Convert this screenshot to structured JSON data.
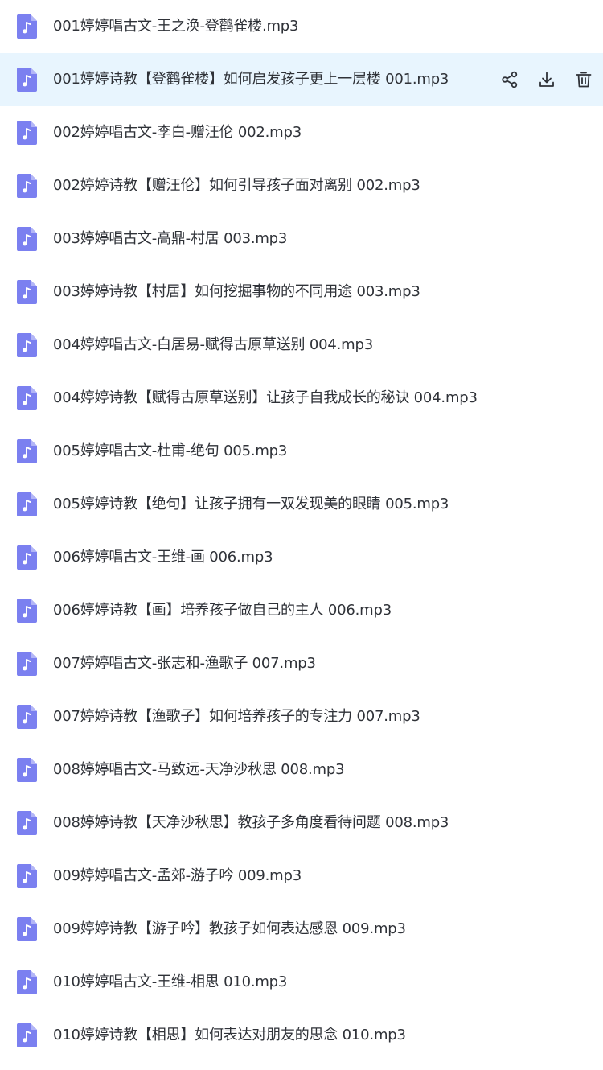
{
  "colors": {
    "icon_fill": "#7b80f0",
    "icon_fold": "#b3b6f7",
    "selected_row_bg": "#e8f5fe",
    "text": "#2f3238"
  },
  "file_icon": "music-file-icon",
  "selected_row_actions": [
    {
      "name": "share-icon"
    },
    {
      "name": "download-icon"
    },
    {
      "name": "delete-icon"
    }
  ],
  "files": [
    {
      "name": "001婷婷唱古文-王之涣-登鹳雀楼.mp3"
    },
    {
      "name": "001婷婷诗教【登鹳雀楼】如何启发孩子更上一层楼 001.mp3",
      "selected": true
    },
    {
      "name": "002婷婷唱古文-李白-赠汪伦 002.mp3"
    },
    {
      "name": "002婷婷诗教【赠汪伦】如何引导孩子面对离别 002.mp3"
    },
    {
      "name": "003婷婷唱古文-高鼎-村居 003.mp3"
    },
    {
      "name": "003婷婷诗教【村居】如何挖掘事物的不同用途 003.mp3"
    },
    {
      "name": "004婷婷唱古文-白居易-赋得古原草送别 004.mp3"
    },
    {
      "name": "004婷婷诗教【赋得古原草送别】让孩子自我成长的秘诀 004.mp3"
    },
    {
      "name": "005婷婷唱古文-杜甫-绝句 005.mp3"
    },
    {
      "name": "005婷婷诗教【绝句】让孩子拥有一双发现美的眼睛 005.mp3"
    },
    {
      "name": "006婷婷唱古文-王维-画 006.mp3"
    },
    {
      "name": "006婷婷诗教【画】培养孩子做自己的主人 006.mp3"
    },
    {
      "name": "007婷婷唱古文-张志和-渔歌子 007.mp3"
    },
    {
      "name": "007婷婷诗教【渔歌子】如何培养孩子的专注力 007.mp3"
    },
    {
      "name": "008婷婷唱古文-马致远-天净沙秋思 008.mp3"
    },
    {
      "name": "008婷婷诗教【天净沙秋思】教孩子多角度看待问题 008.mp3"
    },
    {
      "name": "009婷婷唱古文-孟郊-游子吟 009.mp3"
    },
    {
      "name": "009婷婷诗教【游子吟】教孩子如何表达感恩 009.mp3"
    },
    {
      "name": "010婷婷唱古文-王维-相思 010.mp3"
    },
    {
      "name": "010婷婷诗教【相思】如何表达对朋友的思念 010.mp3"
    }
  ]
}
